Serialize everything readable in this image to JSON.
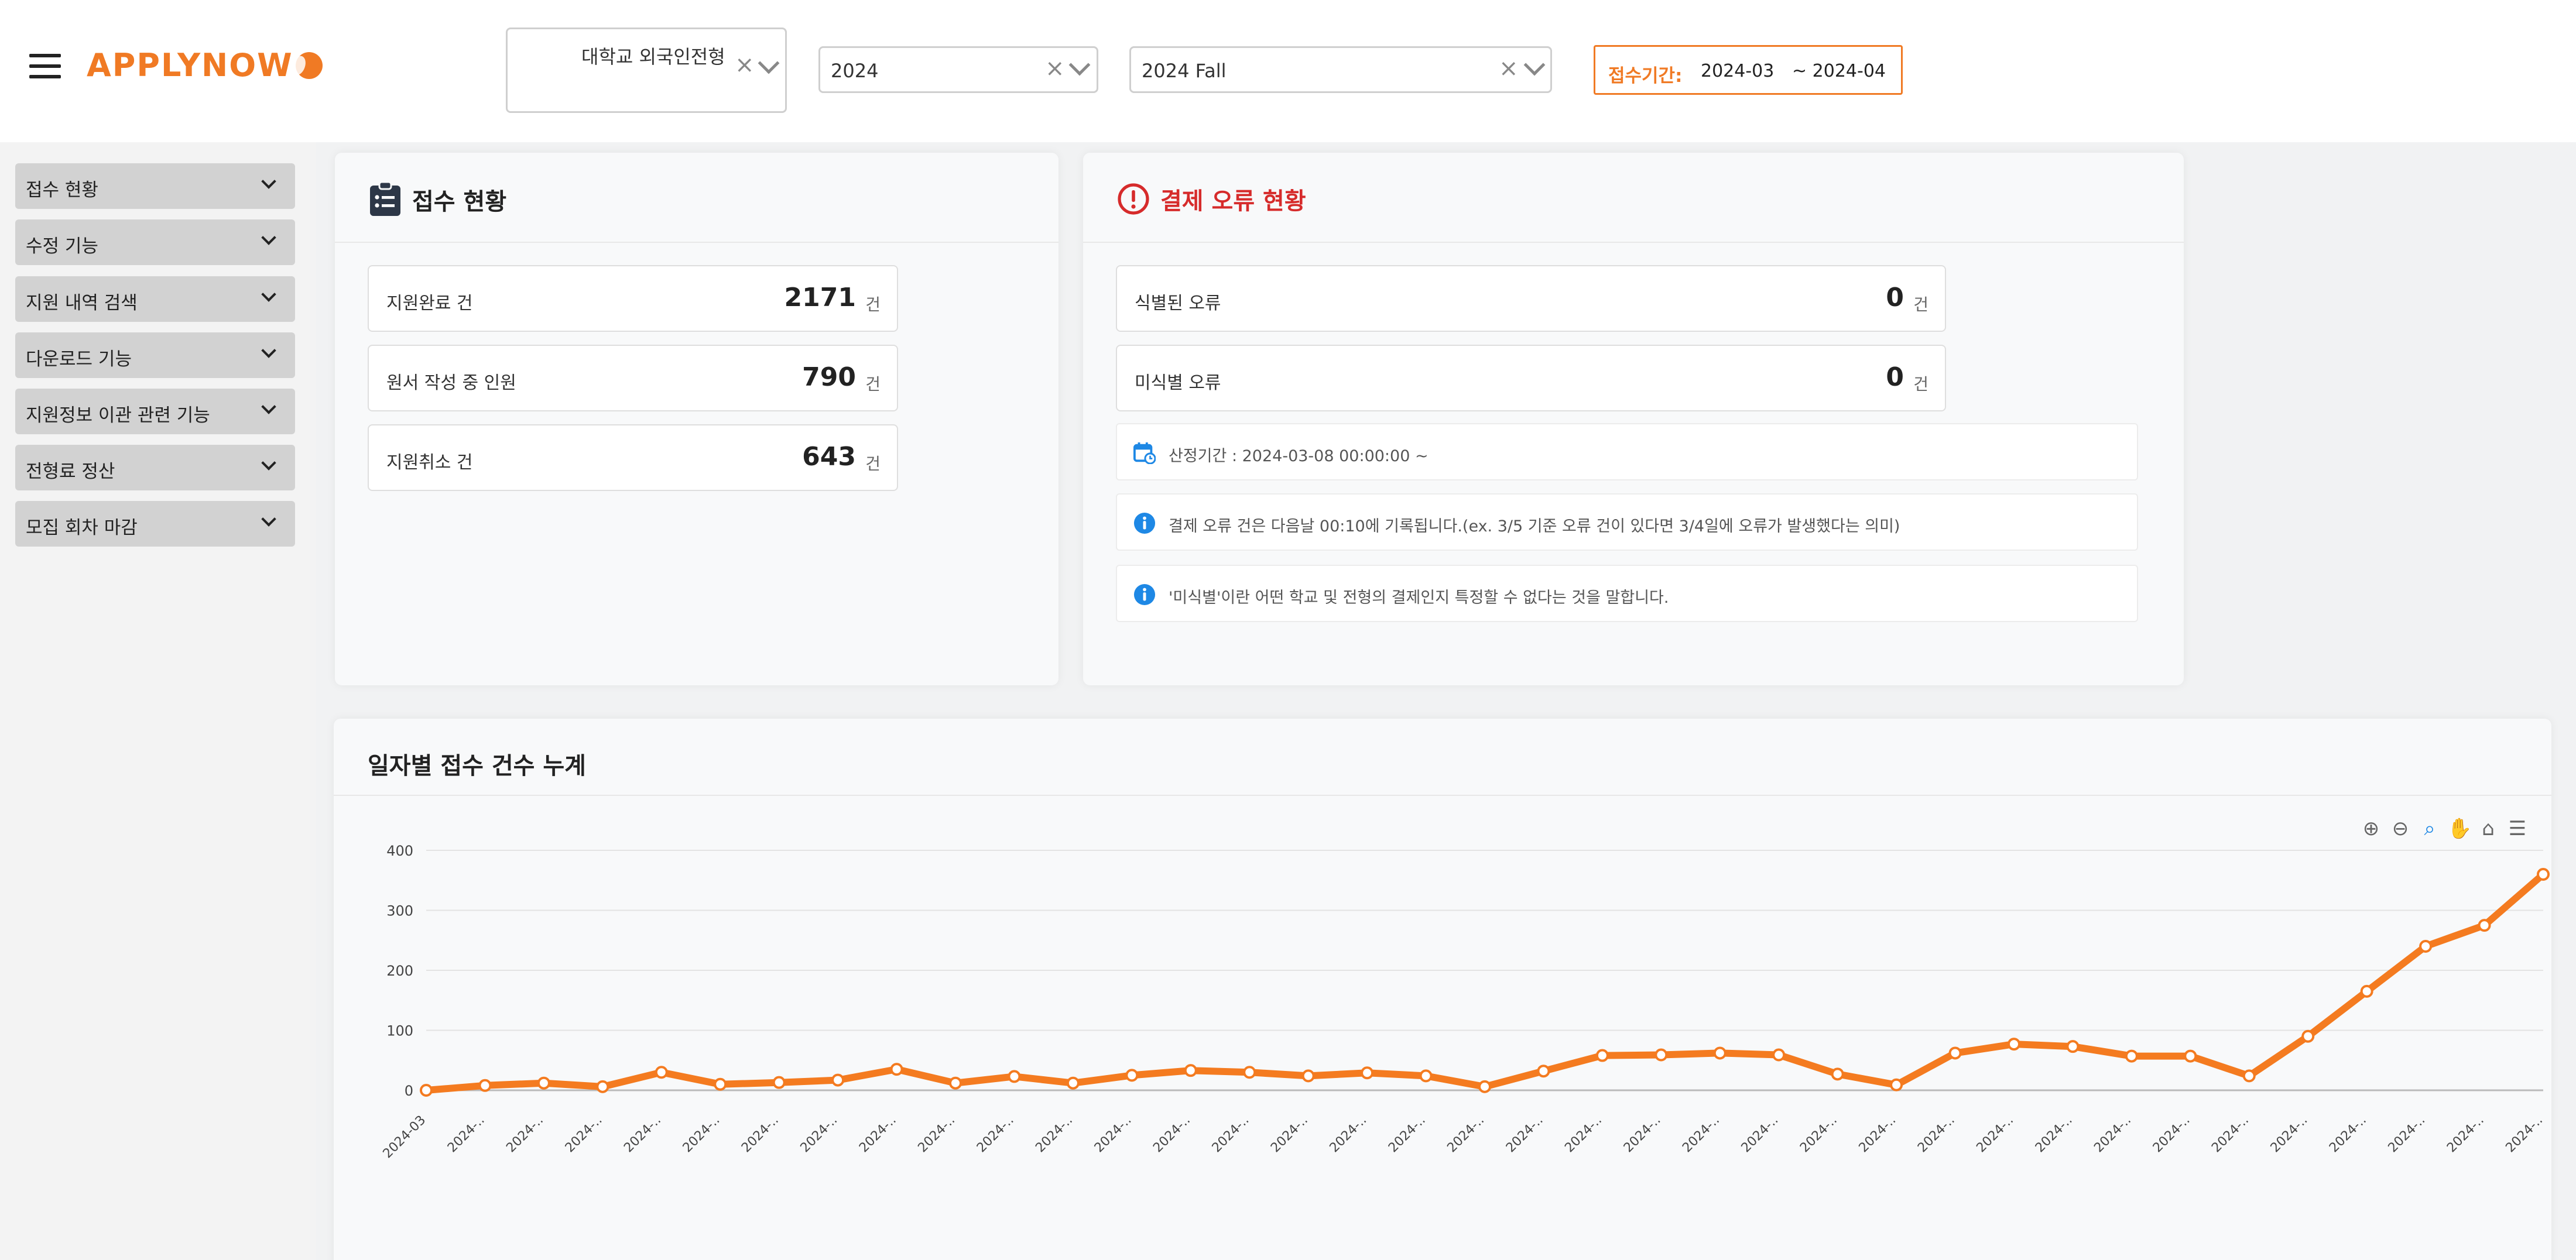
{
  "header": {
    "logo_text": "APPLYNOW",
    "select_type": "대학교 외국인전형",
    "select_year": "2024",
    "select_term": "2024 Fall",
    "clear_symbol": "×",
    "period_label": "접수기간:",
    "period_from": "2024-03",
    "period_to": "~ 2024-04",
    "accent_color": "#f07a24"
  },
  "sidebar": {
    "items": [
      {
        "label": "접수 현황"
      },
      {
        "label": "수정 기능"
      },
      {
        "label": "지원 내역 검색"
      },
      {
        "label": "다운로드 기능"
      },
      {
        "label": "지원정보 이관 관련 기능"
      },
      {
        "label": "전형료 정산"
      },
      {
        "label": "모집 회차 마감"
      }
    ]
  },
  "reception": {
    "title": "접수 현황",
    "icon": "clipboard-list-icon",
    "stats": [
      {
        "label": "지원완료 건",
        "value": "2171",
        "unit": "건"
      },
      {
        "label": "원서 작성 중 인원",
        "value": "790",
        "unit": "건"
      },
      {
        "label": "지원취소 건",
        "value": "643",
        "unit": "건"
      }
    ]
  },
  "payment": {
    "title": "결제 오류 현황",
    "icon": "alert-circle-icon",
    "title_color": "#d62b2b",
    "stats": [
      {
        "label": "식별된 오류",
        "value": "0",
        "unit": "건"
      },
      {
        "label": "미식별 오류",
        "value": "0",
        "unit": "건"
      }
    ],
    "infos": [
      {
        "icon": "calendar-icon",
        "text": "산정기간 : 2024-03-08 00:00:00 ~"
      },
      {
        "icon": "info-icon",
        "text": "결제 오류 건은 다음날 00:10에 기록됩니다.(ex. 3/5 기준 오류 건이 있다면 3/4일에 오류가 발생했다는 의미)"
      },
      {
        "icon": "info-icon",
        "text": "'미식별'이란 어떤 학교 및 전형의 결제인지 특정할 수 없다는 것을 말합니다."
      }
    ]
  },
  "chart": {
    "title": "일자별 접수 건수 누계",
    "toolbar": [
      "zoom-in-icon",
      "zoom-out-icon",
      "zoom-select-icon",
      "pan-hand-icon",
      "home-icon",
      "menu-icon"
    ]
  },
  "chart_data": {
    "type": "line",
    "title": "일자별 접수 건수 누계",
    "xlabel": "",
    "ylabel": "",
    "ylim": [
      0,
      400
    ],
    "yticks": [
      0,
      100,
      200,
      300,
      400
    ],
    "grid": true,
    "color": "#f47b20",
    "categories": [
      "2024-03",
      "2024-..",
      "2024-..",
      "2024-..",
      "2024-..",
      "2024-..",
      "2024-..",
      "2024-..",
      "2024-..",
      "2024-..",
      "2024-..",
      "2024-..",
      "2024-..",
      "2024-..",
      "2024-..",
      "2024-..",
      "2024-..",
      "2024-..",
      "2024-..",
      "2024-..",
      "2024-..",
      "2024-..",
      "2024-..",
      "2024-..",
      "2024-..",
      "2024-..",
      "2024-..",
      "2024-..",
      "2024-..",
      "2024-..",
      "2024-..",
      "2024-..",
      "2024-..",
      "2024-..",
      "2024-..",
      "2024-..",
      "2024-..",
      "2024-.."
    ],
    "series": [
      {
        "values": [
          0,
          8,
          12,
          6,
          30,
          10,
          13,
          17,
          35,
          12,
          23,
          12,
          25,
          33,
          30,
          24,
          29,
          24,
          6,
          32,
          58,
          59,
          62,
          59,
          27,
          9,
          62,
          77,
          73,
          57,
          57,
          24,
          90,
          165,
          240,
          275,
          360
        ]
      }
    ]
  }
}
